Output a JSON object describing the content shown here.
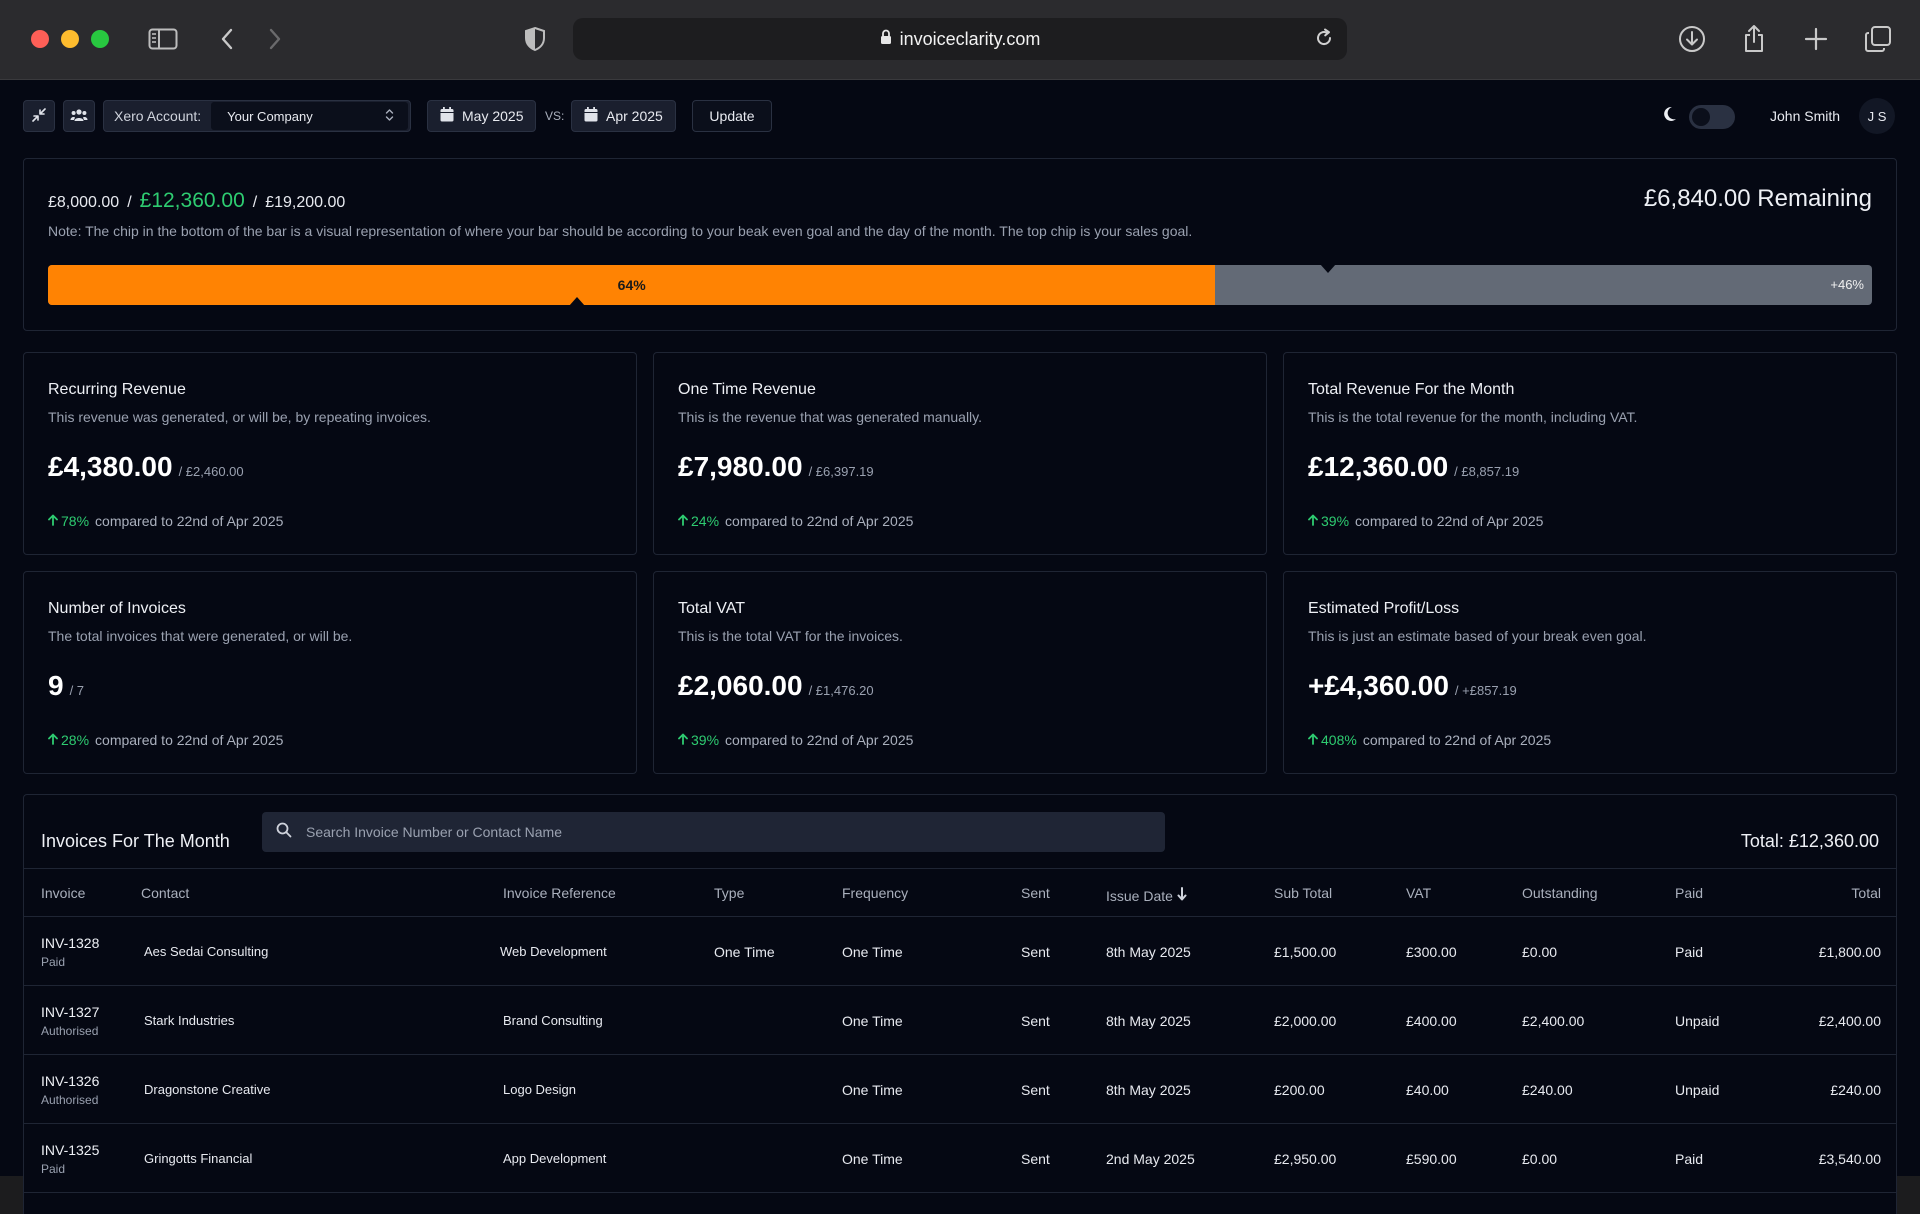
{
  "browser": {
    "url": "invoiceclarity.com"
  },
  "toolbar": {
    "xero_label": "Xero Account:",
    "account_value": "Your Company",
    "date_current": "May 2025",
    "vs_label": "VS:",
    "date_compare": "Apr 2025",
    "update_label": "Update",
    "user_name": "John Smith",
    "user_initials": "J S"
  },
  "goal": {
    "break_even": "£8,000.00",
    "current": "£12,360.00",
    "sales_goal": "£19,200.00",
    "remaining": "£6,840.00 Remaining",
    "note": "Note: The chip in the bottom of the bar is a visual representation of where your bar should be according to your beak even goal and the day of the month. The top chip is your sales goal.",
    "progress_label": "64%",
    "progress_fraction": 0.64,
    "extra_label": "+46%",
    "bottom_chip_fraction": 0.29,
    "top_chip_fraction": 0.702,
    "progress_color": "#ff8303"
  },
  "cards": [
    {
      "title": "Recurring Revenue",
      "desc": "This revenue was generated, or will be, by repeating invoices.",
      "value": "£4,380.00",
      "prev": "/ £2,460.00",
      "pct": "78%",
      "cmp": "compared to 22nd of Apr 2025"
    },
    {
      "title": "One Time Revenue",
      "desc": "This is the revenue that was generated manually.",
      "value": "£7,980.00",
      "prev": "/ £6,397.19",
      "pct": "24%",
      "cmp": "compared to 22nd of Apr 2025"
    },
    {
      "title": "Total Revenue For the Month",
      "desc": "This is the total revenue for the month, including VAT.",
      "value": "£12,360.00",
      "prev": "/ £8,857.19",
      "pct": "39%",
      "cmp": "compared to 22nd of Apr 2025"
    },
    {
      "title": "Number of Invoices",
      "desc": "The total invoices that were generated, or will be.",
      "value": "9",
      "prev": "/ 7",
      "pct": "28%",
      "cmp": "compared to 22nd of Apr 2025"
    },
    {
      "title": "Total VAT",
      "desc": "This is the total VAT for the invoices.",
      "value": "£2,060.00",
      "prev": "/ £1,476.20",
      "pct": "39%",
      "cmp": "compared to 22nd of Apr 2025"
    },
    {
      "title": "Estimated Profit/Loss",
      "desc": "This is just an estimate based of your break even goal.",
      "value": "+£4,360.00",
      "prev": "/ +£857.19",
      "pct": "408%",
      "cmp": "compared to 22nd of Apr 2025"
    }
  ],
  "invoices": {
    "title": "Invoices For The Month",
    "search_placeholder": "Search Invoice Number or Contact Name",
    "total": "Total: £12,360.00",
    "headers": {
      "invoice": "Invoice",
      "contact": "Contact",
      "reference": "Invoice Reference",
      "type": "Type",
      "frequency": "Frequency",
      "sent": "Sent",
      "issue_date": "Issue Date",
      "sub_total": "Sub Total",
      "vat": "VAT",
      "outstanding": "Outstanding",
      "paid": "Paid",
      "total": "Total"
    },
    "rows": [
      {
        "number": "INV-1328",
        "status": "Paid",
        "contact": "Aes Sedai Consulting",
        "reference": "Web Development",
        "type": "One Time",
        "frequency": "One Time",
        "sent": "Sent",
        "issue_date": "8th May 2025",
        "sub_total": "£1,500.00",
        "vat": "£300.00",
        "outstanding": "£0.00",
        "paid": "Paid",
        "total": "£1,800.00"
      },
      {
        "number": "INV-1327",
        "status": "Authorised",
        "contact": "Stark Industries",
        "reference": "Brand Consulting",
        "type": "",
        "frequency": "One Time",
        "sent": "Sent",
        "issue_date": "8th May 2025",
        "sub_total": "£2,000.00",
        "vat": "£400.00",
        "outstanding": "£2,400.00",
        "paid": "Unpaid",
        "total": "£2,400.00"
      },
      {
        "number": "INV-1326",
        "status": "Authorised",
        "contact": "Dragonstone Creative",
        "reference": "Logo Design",
        "type": "",
        "frequency": "One Time",
        "sent": "Sent",
        "issue_date": "8th May 2025",
        "sub_total": "£200.00",
        "vat": "£40.00",
        "outstanding": "£240.00",
        "paid": "Unpaid",
        "total": "£240.00"
      },
      {
        "number": "INV-1325",
        "status": "Paid",
        "contact": "Gringotts Financial",
        "reference": "App Development",
        "type": "",
        "frequency": "One Time",
        "sent": "Sent",
        "issue_date": "2nd May 2025",
        "sub_total": "£2,950.00",
        "vat": "£590.00",
        "outstanding": "£0.00",
        "paid": "Paid",
        "total": "£3,540.00"
      }
    ]
  }
}
